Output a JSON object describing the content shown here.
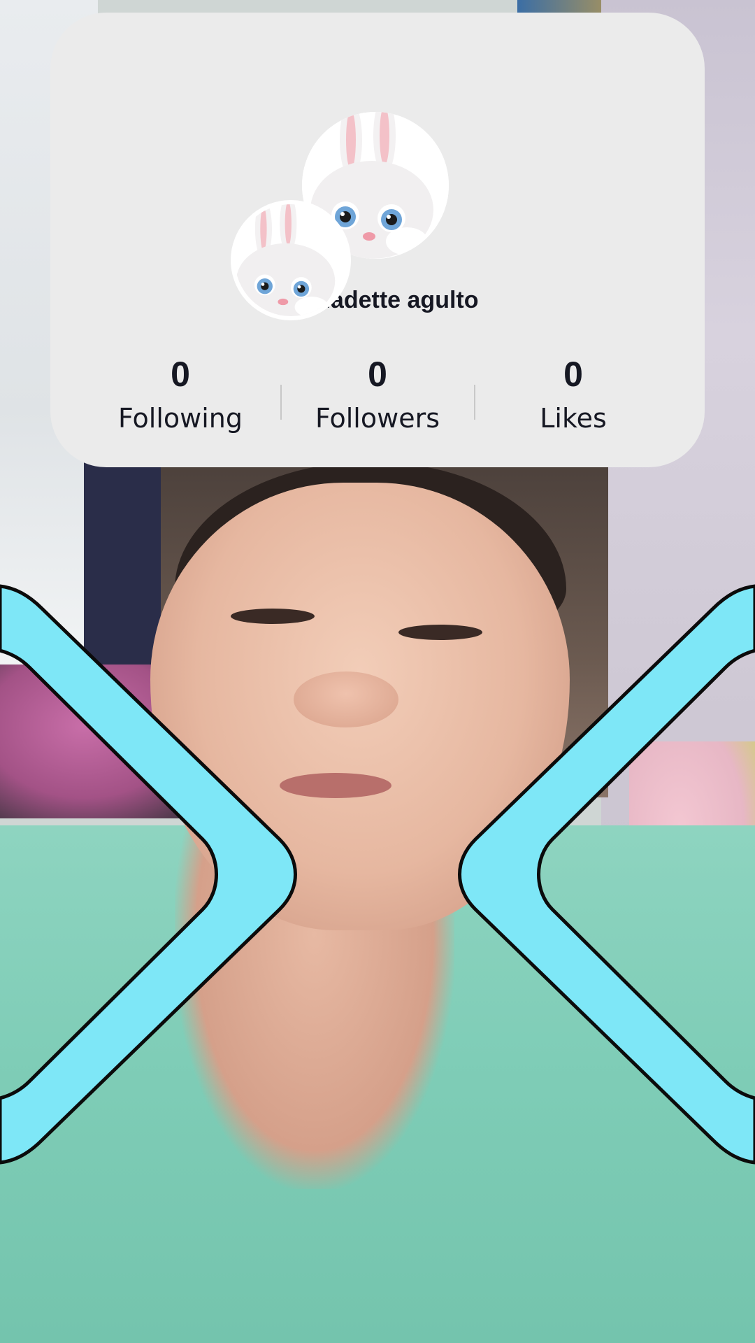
{
  "profile": {
    "username": "Bernadette agulto",
    "large_avatar": "snowball-bunny-avatar",
    "small_avatar": "snowball-bunny-avatar"
  },
  "stats": {
    "following": {
      "value": "0",
      "label": "Following"
    },
    "followers": {
      "value": "0",
      "label": "Followers"
    },
    "likes": {
      "value": "0",
      "label": "Likes"
    }
  },
  "effect": {
    "type": "camera-frame-overlay",
    "frame_color": "#7ee7f7",
    "outline_color": "#0b0b0b"
  },
  "colors": {
    "card_background": "#ebebeb",
    "text_primary": "#161823",
    "divider": "#c8c8c8"
  }
}
